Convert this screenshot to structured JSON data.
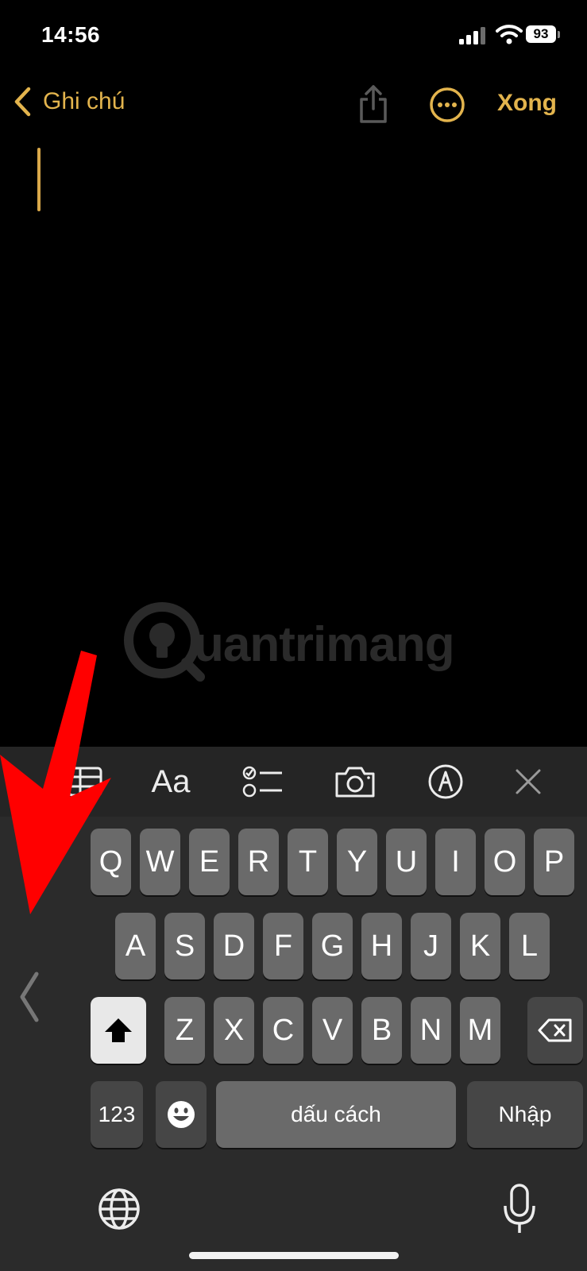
{
  "status_bar": {
    "time": "14:56",
    "battery": "93"
  },
  "nav": {
    "back_label": "Ghi chú",
    "done_label": "Xong"
  },
  "watermark": {
    "text": "uantrimang"
  },
  "toolbar": {
    "format_label": "Aa"
  },
  "keyboard": {
    "row1": [
      "Q",
      "W",
      "E",
      "R",
      "T",
      "Y",
      "U",
      "I",
      "O",
      "P"
    ],
    "row2": [
      "A",
      "S",
      "D",
      "F",
      "G",
      "H",
      "J",
      "K",
      "L"
    ],
    "row3": [
      "Z",
      "X",
      "C",
      "V",
      "B",
      "N",
      "M"
    ],
    "numbers_label": "123",
    "space_label": "dấu cách",
    "return_label": "Nhập"
  },
  "colors": {
    "accent": "#e3b44d",
    "annotation_arrow": "#ff0000"
  }
}
